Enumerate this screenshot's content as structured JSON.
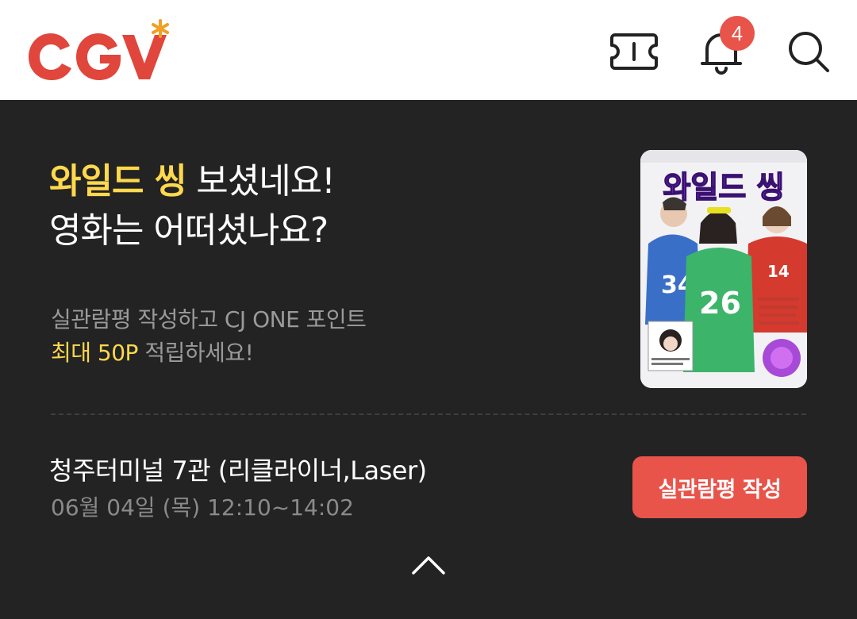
{
  "header": {
    "logo": "CGV",
    "icons": [
      "ticket-icon",
      "bell-icon",
      "search-icon"
    ],
    "notification_count": "4"
  },
  "review_prompt": {
    "movie_title": "와일드 씽",
    "headline_rest": " 보셨네요!",
    "headline_line2": "영화는 어떠셨나요?",
    "sub_line1": "실관람평 작성하고 CJ ONE 포인트",
    "sub_highlight": "최대 50P",
    "sub_line2_rest": " 적립하세요!",
    "poster": {
      "title_text": "와일드 씽"
    }
  },
  "booking": {
    "theater": "청주터미널 7관 (리클라이너,Laser)",
    "showtime": "06월 04일 (목) 12:10~14:02"
  },
  "actions": {
    "review_button": "실관람평 작성"
  },
  "colors": {
    "brand": "#e0463c",
    "accent_yellow": "#ffd84d",
    "button": "#e8534a",
    "background": "#232323"
  }
}
